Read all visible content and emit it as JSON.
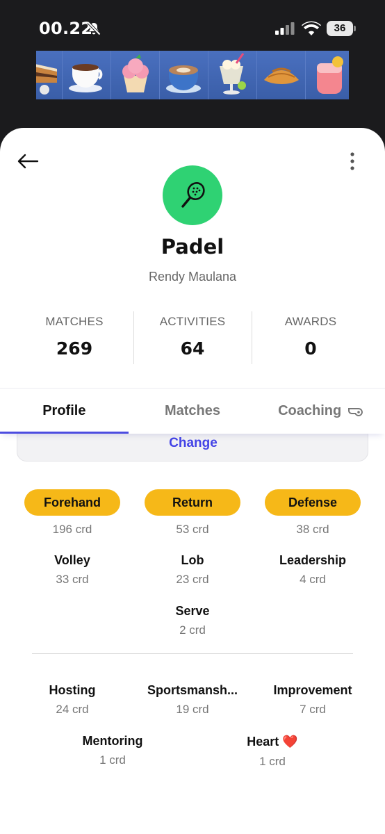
{
  "status_bar": {
    "time": "00.22",
    "battery": "36"
  },
  "banner": {
    "items": [
      "cake-slice-icon",
      "coffee-cup-icon",
      "cupcake-icon",
      "latte-icon",
      "parfait-icon",
      "croissant-icon",
      "fruit-drink-icon"
    ]
  },
  "header": {
    "sport": "Padel",
    "user_name": "Rendy Maulana",
    "avatar_color": "#2fd273"
  },
  "stats": [
    {
      "label": "MATCHES",
      "value": "269"
    },
    {
      "label": "ACTIVITIES",
      "value": "64"
    },
    {
      "label": "AWARDS",
      "value": "0"
    }
  ],
  "tabs": [
    {
      "label": "Profile",
      "active": true
    },
    {
      "label": "Matches",
      "active": false
    },
    {
      "label": "Coaching",
      "active": false
    }
  ],
  "change_link": "Change",
  "top_skills": [
    {
      "name": "Forehand",
      "count": "196 crd"
    },
    {
      "name": "Return",
      "count": "53 crd"
    },
    {
      "name": "Defense",
      "count": "38 crd"
    }
  ],
  "other_skills": [
    {
      "name": "Volley",
      "count": "33 crd"
    },
    {
      "name": "Lob",
      "count": "23 crd"
    },
    {
      "name": "Leadership",
      "count": "4 crd"
    },
    {
      "name": "Serve",
      "count": "2 crd"
    }
  ],
  "traits": [
    {
      "name": "Hosting",
      "count": "24 crd"
    },
    {
      "name": "Sportsmansh...",
      "count": "19 crd"
    },
    {
      "name": "Improvement",
      "count": "7 crd"
    },
    {
      "name": "Mentoring",
      "count": "1 crd"
    },
    {
      "name": "Heart",
      "emoji": "❤️",
      "count": "1 crd"
    }
  ],
  "colors": {
    "accent": "#4c4ce0",
    "pill": "#f6b818",
    "link": "#4343e6"
  }
}
